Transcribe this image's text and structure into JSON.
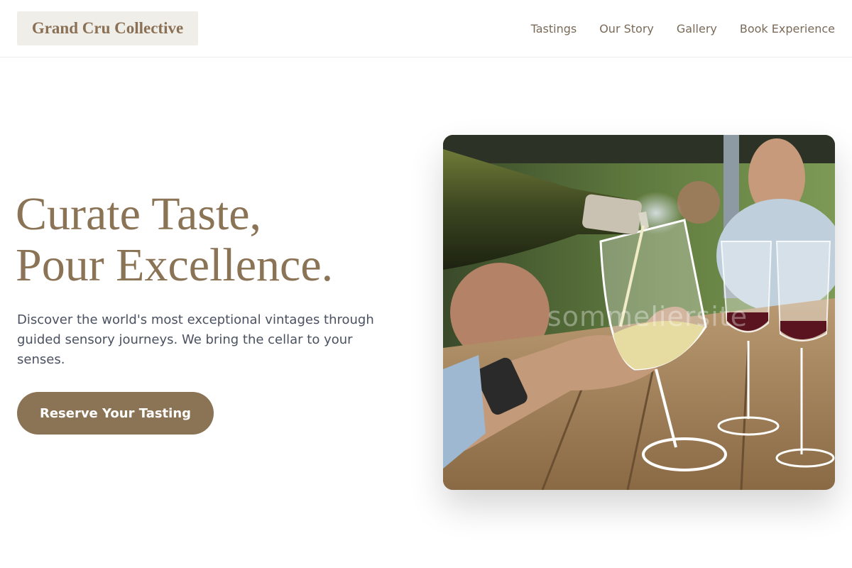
{
  "header": {
    "brand": "Grand Cru Collective",
    "nav": [
      {
        "label": "Tastings"
      },
      {
        "label": "Our Story"
      },
      {
        "label": "Gallery"
      },
      {
        "label": "Book Experience"
      }
    ]
  },
  "hero": {
    "headline_line1": "Curate Taste,",
    "headline_line2": "Pour Excellence.",
    "description": "Discover the world's most exceptional vintages through guided sensory journeys. We bring the cellar to your senses.",
    "cta_label": "Reserve Your Tasting",
    "image_watermark": "sommeliersite"
  },
  "colors": {
    "accent": "#8b7356",
    "nav_text": "#7a6a58",
    "body_text": "#4a5160",
    "logo_bg": "#f0eee9"
  }
}
